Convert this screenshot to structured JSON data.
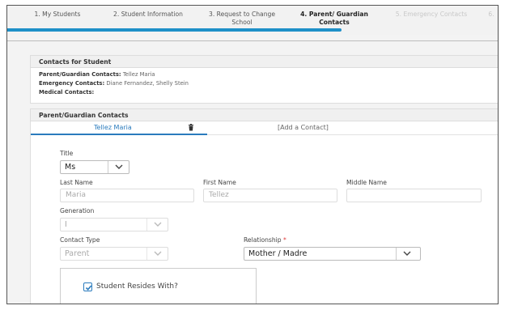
{
  "steps": [
    {
      "label": "1. My Students",
      "state": "done"
    },
    {
      "label": "2. Student Information",
      "state": "done"
    },
    {
      "label": "3. Request to Change School",
      "state": "done"
    },
    {
      "label": "4. Parent/ Guardian Contacts",
      "state": "active"
    },
    {
      "label": "5. Emergency Contacts",
      "state": "disabled"
    },
    {
      "label": "6.",
      "state": "disabled"
    }
  ],
  "summary": {
    "title": "Contacts for Student",
    "parent_label": "Parent/Guardian Contacts:",
    "parent_value": "Tellez Maria",
    "emergency_label": "Emergency Contacts:",
    "emergency_value": "Diane Fernandez, Shelly Stein",
    "medical_label": "Medical Contacts:",
    "medical_value": ""
  },
  "guardian": {
    "title": "Parent/Guardian Contacts",
    "tab_active": "Tellez Maria",
    "tab_add": "[Add a Contact]"
  },
  "form": {
    "title_label": "Title",
    "title_value": "Ms",
    "last_name_label": "Last Name",
    "last_name_value": "Maria",
    "first_name_label": "First Name",
    "first_name_value": "Tellez",
    "middle_name_label": "Middle Name",
    "middle_name_value": "",
    "generation_label": "Generation",
    "generation_value": "I",
    "contact_type_label": "Contact Type",
    "contact_type_value": "Parent",
    "relationship_label": "Relationship",
    "relationship_required": "*",
    "relationship_value": "Mother / Madre",
    "resides_label": "Student Resides With?",
    "resides_checked": true
  },
  "colors": {
    "accent": "#1e90c8",
    "tab_accent": "#2a7bbd",
    "required": "#dd3333"
  },
  "icons": {
    "dropdown": "chevron-down-icon",
    "delete": "trash-icon",
    "check": "check-icon"
  }
}
